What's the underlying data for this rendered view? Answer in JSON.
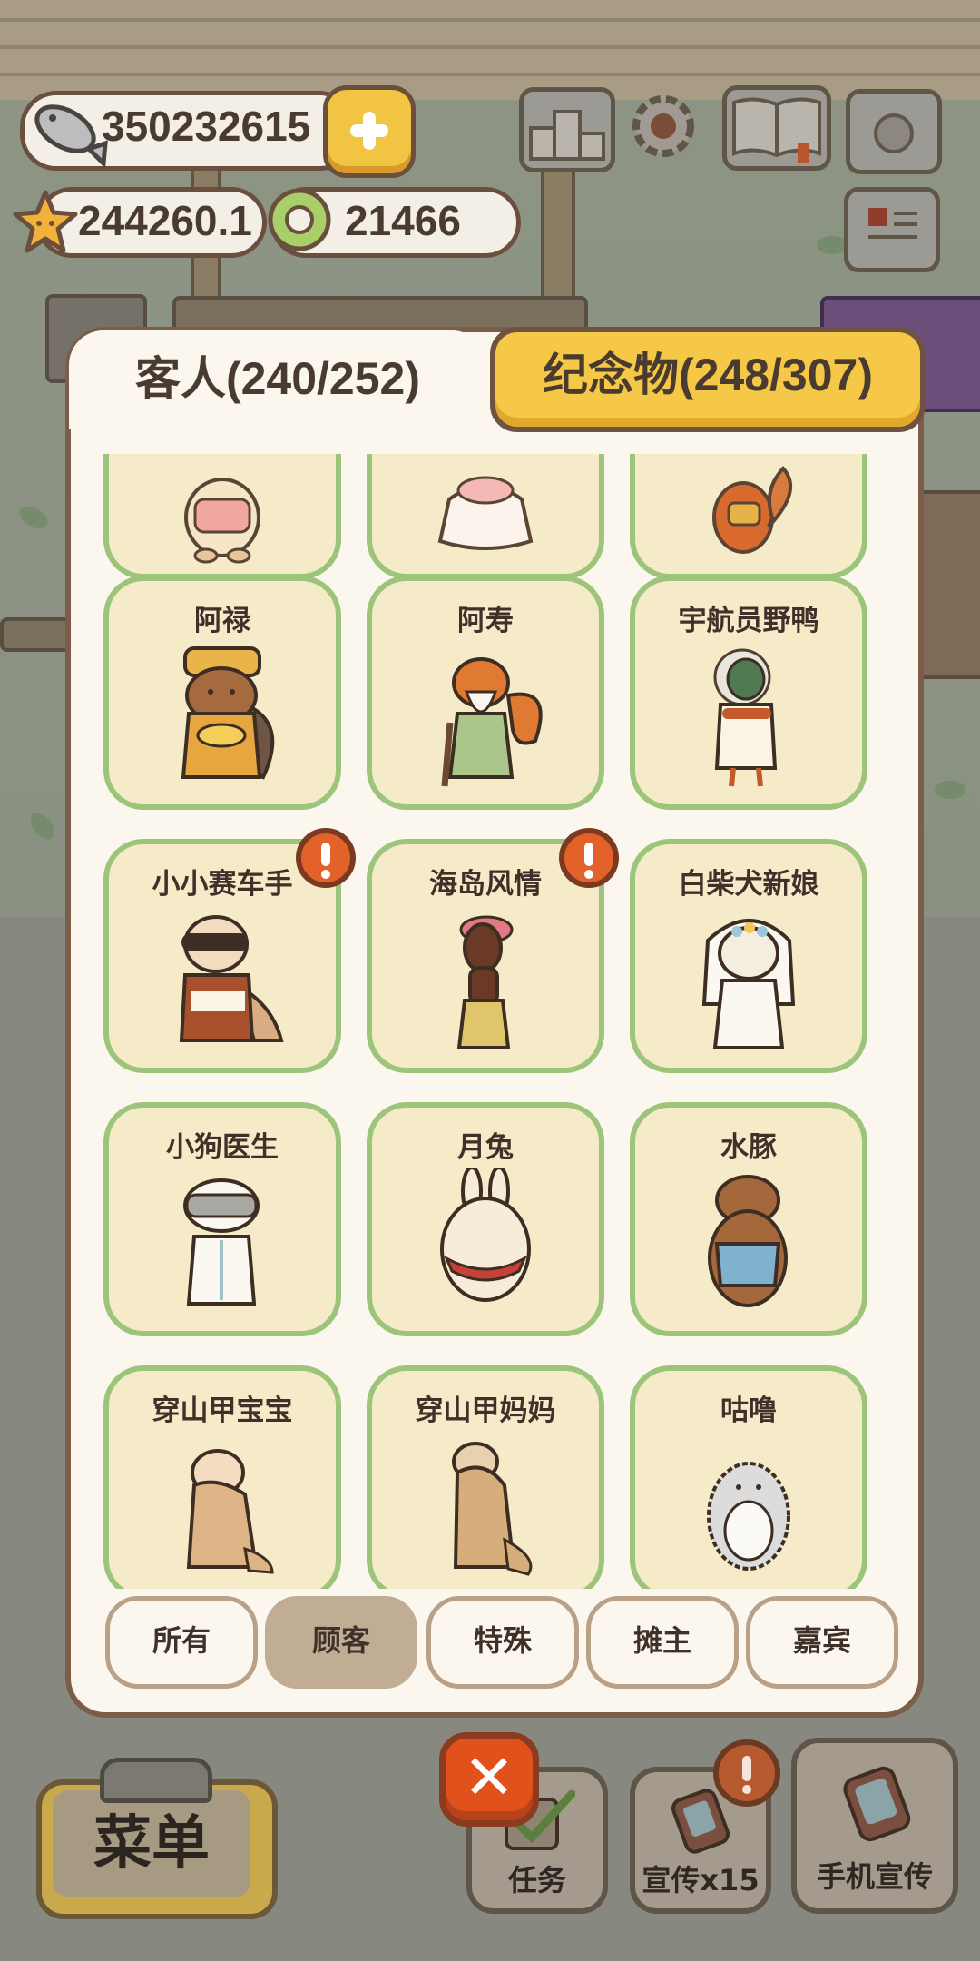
{
  "hud": {
    "fish_count": "350232615",
    "star_count": "244260.1",
    "coin_count": "21466"
  },
  "tabs": {
    "guests_label": "客人(240/252)",
    "souvenirs_label": "纪念物(248/307)"
  },
  "guests": [
    {
      "name": "",
      "creature": "hamster-nurse",
      "alert": false
    },
    {
      "name": "",
      "creature": "sheep-dress",
      "alert": false
    },
    {
      "name": "",
      "creature": "squirrel-red",
      "alert": false
    },
    {
      "name": "阿禄",
      "creature": "capybara-official",
      "alert": false
    },
    {
      "name": "阿寿",
      "creature": "squirrel-elder",
      "alert": false
    },
    {
      "name": "宇航员野鸭",
      "creature": "duck-astronaut",
      "alert": false
    },
    {
      "name": "小小赛车手",
      "creature": "otter-racer",
      "alert": true
    },
    {
      "name": "海岛风情",
      "creature": "dachshund-hula",
      "alert": true
    },
    {
      "name": "白柴犬新娘",
      "creature": "shiba-bride",
      "alert": false
    },
    {
      "name": "小狗医生",
      "creature": "dog-doctor",
      "alert": false
    },
    {
      "name": "月兔",
      "creature": "moon-rabbit",
      "alert": false
    },
    {
      "name": "水豚",
      "creature": "capybara",
      "alert": false
    },
    {
      "name": "穿山甲宝宝",
      "creature": "baby-pangolin",
      "alert": false
    },
    {
      "name": "穿山甲妈妈",
      "creature": "mama-pangolin",
      "alert": false
    },
    {
      "name": "咕噜",
      "creature": "hedgehog-gulu",
      "alert": false
    }
  ],
  "filters": [
    {
      "label": "所有",
      "active": false
    },
    {
      "label": "顾客",
      "active": true
    },
    {
      "label": "特殊",
      "active": false
    },
    {
      "label": "摊主",
      "active": false
    },
    {
      "label": "嘉宾",
      "active": false
    }
  ],
  "bottom": {
    "menu_label": "菜单",
    "tasks_label": "任务",
    "promo_label": "宣传x15",
    "phone_promo_label": "手机宣传"
  },
  "colors": {
    "card_bg": "#f6ebc9",
    "card_border": "#9cc47a",
    "tab_active": "#f6c847",
    "alert": "#e2622a",
    "close_button": "#e0511b"
  }
}
